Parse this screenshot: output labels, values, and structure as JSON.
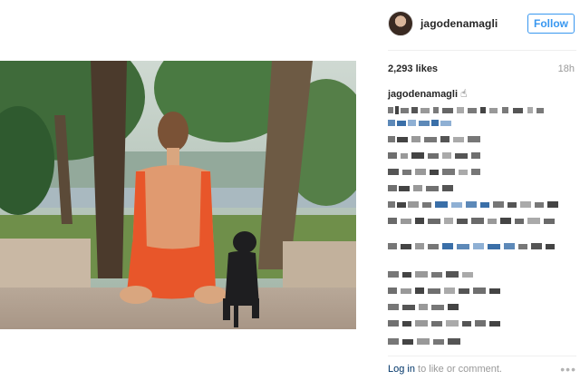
{
  "post": {
    "username": "jagodenamagli",
    "follow_label": "Follow",
    "likes": "2,293 likes",
    "time": "18h",
    "caption_username": "jagodenamagli",
    "caption_emoji": "☝︎"
  },
  "footer": {
    "login_link": "Log in",
    "login_rest": " to like or comment.",
    "more_icon": "more-options-icon"
  },
  "colors": {
    "accent": "#3897f0",
    "link": "#003569",
    "muted": "#999999",
    "swimsuit": "#e8562a"
  }
}
